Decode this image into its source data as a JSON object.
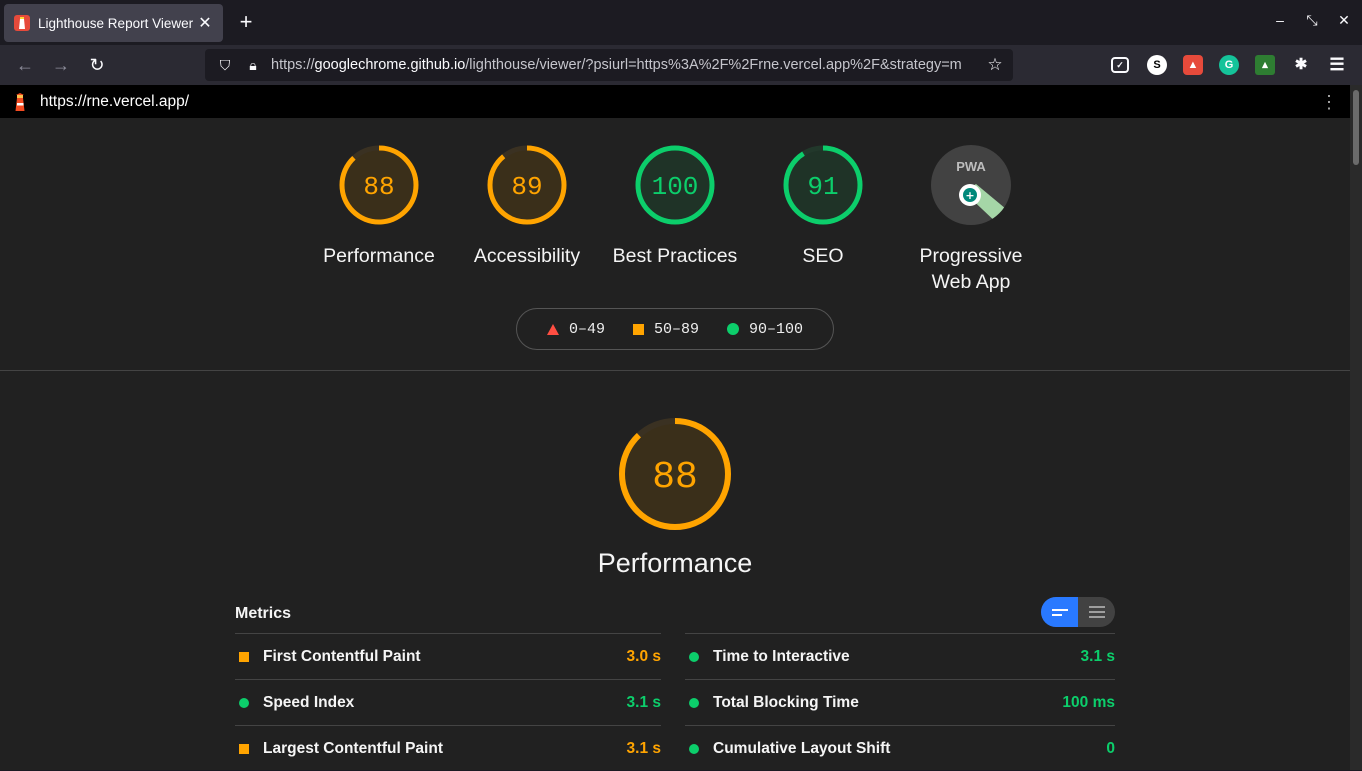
{
  "browser": {
    "tab_title": "Lighthouse Report Viewer",
    "url_domain": "googlechrome.github.io",
    "url_prefix": "https://",
    "url_rest": "/lighthouse/viewer/?psiurl=https%3A%2F%2Frne.vercel.app%2F&strategy=m"
  },
  "report": {
    "site_url": "https://rne.vercel.app/",
    "categories": [
      {
        "score": "88",
        "label": "Performance",
        "score_value": 88
      },
      {
        "score": "89",
        "label": "Accessibility",
        "score_value": 89
      },
      {
        "score": "100",
        "label": "Best Practices",
        "score_value": 100
      },
      {
        "score": "91",
        "label": "SEO",
        "score_value": 91
      },
      {
        "label_line1": "Progressive",
        "label_line2": "Web App",
        "badge_text": "PWA"
      }
    ],
    "legend": [
      {
        "range": "0–49"
      },
      {
        "range": "50–89"
      },
      {
        "range": "90–100"
      }
    ],
    "performance": {
      "score": "88",
      "score_value": 88,
      "title": "Performance",
      "metrics_title": "Metrics",
      "metrics_left": [
        {
          "name": "First Contentful Paint",
          "value": "3.0 s",
          "rating": "average"
        },
        {
          "name": "Speed Index",
          "value": "3.1 s",
          "rating": "pass"
        },
        {
          "name": "Largest Contentful Paint",
          "value": "3.1 s",
          "rating": "average"
        }
      ],
      "metrics_right": [
        {
          "name": "Time to Interactive",
          "value": "3.1 s",
          "rating": "pass"
        },
        {
          "name": "Total Blocking Time",
          "value": "100 ms",
          "rating": "pass"
        },
        {
          "name": "Cumulative Layout Shift",
          "value": "0",
          "rating": "pass"
        }
      ]
    }
  },
  "colors": {
    "fail": "#ff4e42",
    "average": "#ffa400",
    "pass": "#0cce6b",
    "accent": "#2979ff"
  }
}
